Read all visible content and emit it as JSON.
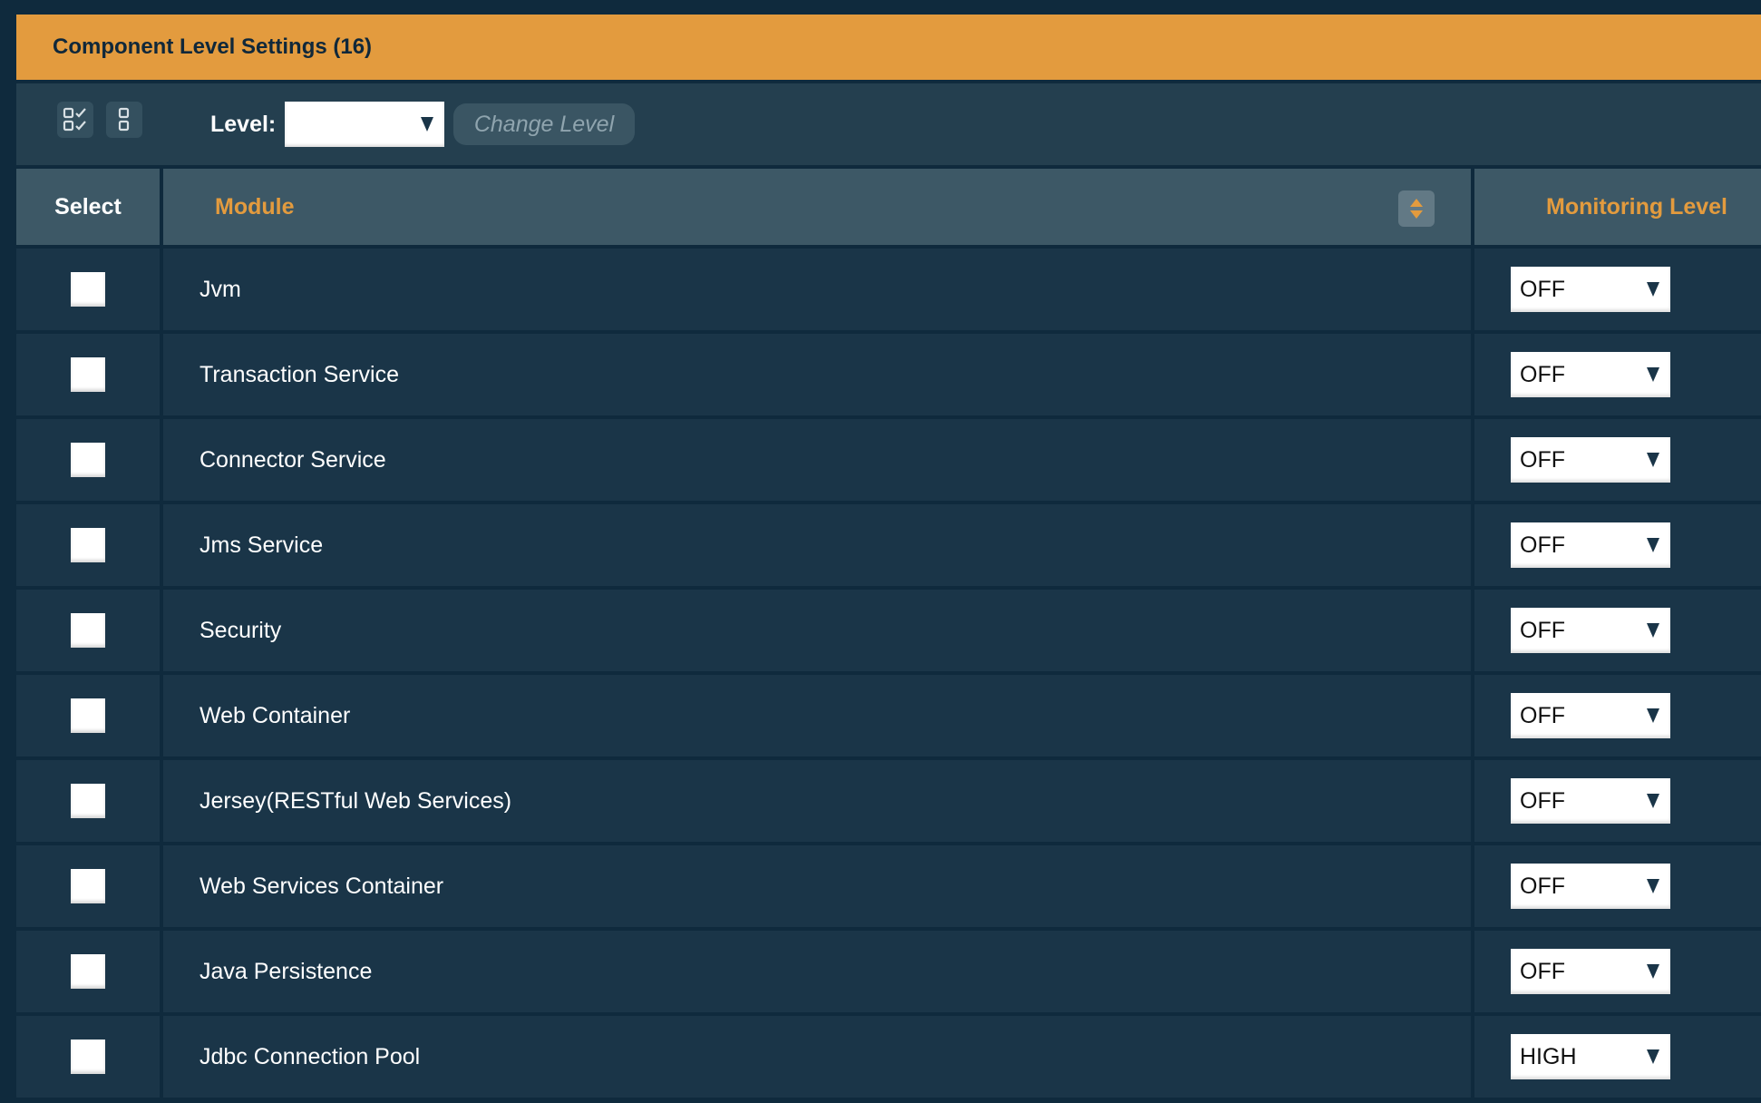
{
  "panel": {
    "title": "Component Level Settings (16)"
  },
  "toolbar": {
    "select_all_icon": "select-all-checkboxes-icon",
    "deselect_all_icon": "deselect-all-checkboxes-icon",
    "level_label": "Level:",
    "level_value": "",
    "change_level_label": "Change Level"
  },
  "table": {
    "columns": {
      "select": "Select",
      "module": "Module",
      "monitoring_level": "Monitoring Level"
    },
    "sort_icon": "sort-up-down-icon",
    "rows": [
      {
        "module": "Jvm",
        "level": "OFF",
        "selected": false
      },
      {
        "module": "Transaction Service",
        "level": "OFF",
        "selected": false
      },
      {
        "module": "Connector Service",
        "level": "OFF",
        "selected": false
      },
      {
        "module": "Jms Service",
        "level": "OFF",
        "selected": false
      },
      {
        "module": "Security",
        "level": "OFF",
        "selected": false
      },
      {
        "module": "Web Container",
        "level": "OFF",
        "selected": false
      },
      {
        "module": "Jersey(RESTful Web Services)",
        "level": "OFF",
        "selected": false
      },
      {
        "module": "Web Services Container",
        "level": "OFF",
        "selected": false
      },
      {
        "module": "Java Persistence",
        "level": "OFF",
        "selected": false
      },
      {
        "module": "Jdbc Connection Pool",
        "level": "HIGH",
        "selected": false
      }
    ]
  },
  "colors": {
    "accent": "#e39b3e",
    "background": "#0f2a3d",
    "toolbar": "#243f4f",
    "header_row": "#3d5866",
    "row": "#1a3548"
  }
}
